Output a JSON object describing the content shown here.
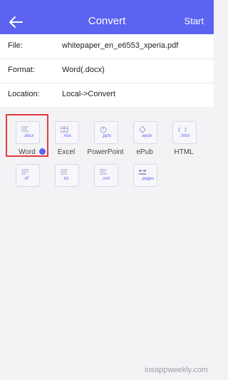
{
  "nav": {
    "title": "Convert",
    "start_label": "Start"
  },
  "info": {
    "file_label": "File:",
    "file_value": "whitepaper_en_e6553_xperia.pdf",
    "format_label": "Format:",
    "format_value": "Word(.docx)",
    "location_label": "Location:",
    "location_value": "Local->Convert"
  },
  "formats": [
    {
      "name": "Word",
      "ext": ".docx",
      "selected": true
    },
    {
      "name": "Excel",
      "ext": ".xlsx"
    },
    {
      "name": "PowerPoint",
      "ext": ".pptx"
    },
    {
      "name": "ePub",
      "ext": ".epub"
    },
    {
      "name": "HTML",
      "ext": ".html"
    },
    {
      "name": "",
      "ext": ".rtf"
    },
    {
      "name": "",
      "ext": ".txt"
    },
    {
      "name": "",
      "ext": ".xml"
    },
    {
      "name": "",
      "ext": ".pages"
    }
  ],
  "watermark": "iosappweekly.com"
}
